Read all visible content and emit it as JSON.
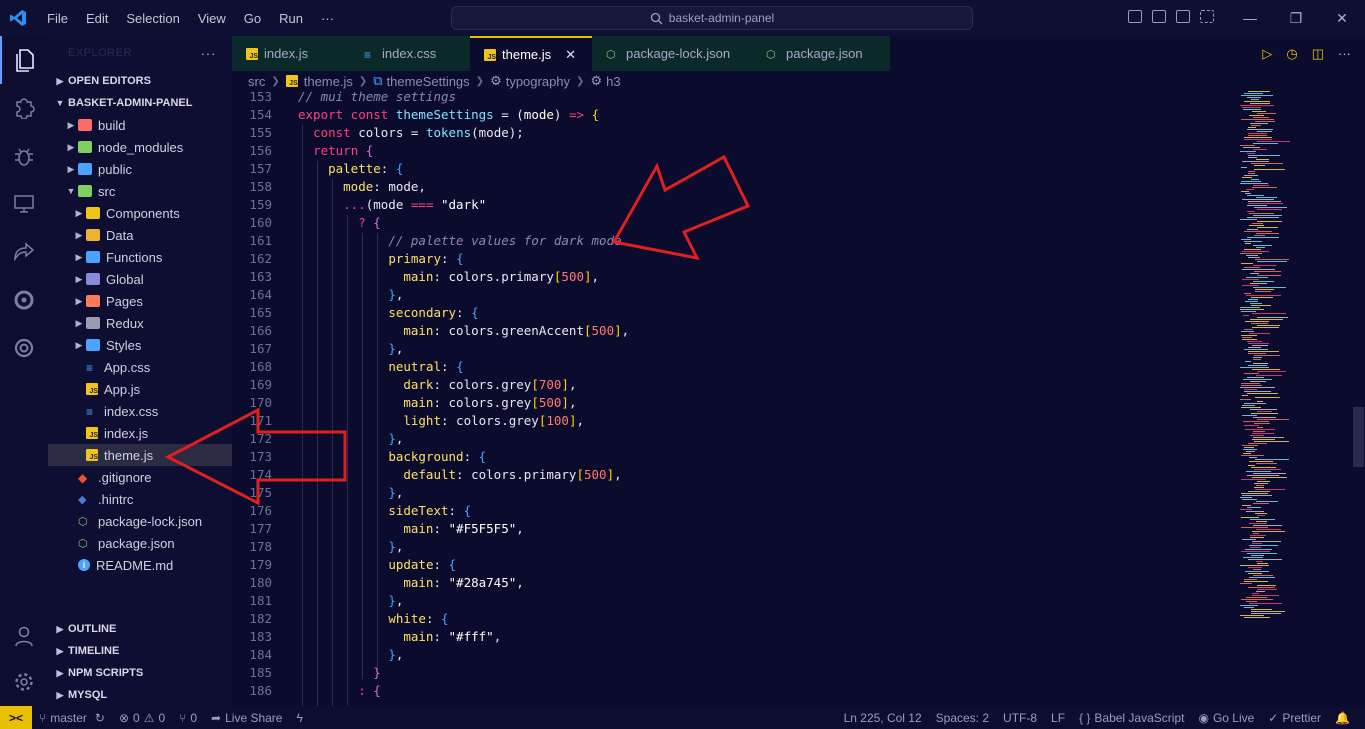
{
  "titlebar": {
    "menu": [
      "File",
      "Edit",
      "Selection",
      "View",
      "Go",
      "Run",
      "···"
    ],
    "search": "basket-admin-panel"
  },
  "sidebar": {
    "header": "EXPLORER",
    "sections": {
      "open_editors": "OPEN EDITORS",
      "project": "BASKET-ADMIN-PANEL",
      "outline": "OUTLINE",
      "timeline": "TIMELINE",
      "npm": "NPM SCRIPTS",
      "mysql": "MYSQL"
    },
    "tree": [
      {
        "label": "build",
        "type": "folder",
        "indent": 1,
        "color": "#ff6b6b"
      },
      {
        "label": "node_modules",
        "type": "folder",
        "indent": 1,
        "color": "#7fd060"
      },
      {
        "label": "public",
        "type": "folder",
        "indent": 1,
        "color": "#4aa3ff"
      },
      {
        "label": "src",
        "type": "folder-open",
        "indent": 1,
        "color": "#7fd060"
      },
      {
        "label": "Components",
        "type": "folder",
        "indent": 2,
        "color": "#f0c419"
      },
      {
        "label": "Data",
        "type": "folder",
        "indent": 2,
        "color": "#f0b030"
      },
      {
        "label": "Functions",
        "type": "folder",
        "indent": 2,
        "color": "#4aa3ff"
      },
      {
        "label": "Global",
        "type": "folder",
        "indent": 2,
        "color": "#8a8ad8"
      },
      {
        "label": "Pages",
        "type": "folder",
        "indent": 2,
        "color": "#ff7a5a"
      },
      {
        "label": "Redux",
        "type": "folder",
        "indent": 2,
        "color": "#9a9ab0"
      },
      {
        "label": "Styles",
        "type": "folder",
        "indent": 2,
        "color": "#4aa3ff"
      },
      {
        "label": "App.css",
        "type": "css",
        "indent": 2
      },
      {
        "label": "App.js",
        "type": "js",
        "indent": 2
      },
      {
        "label": "index.css",
        "type": "css",
        "indent": 2
      },
      {
        "label": "index.js",
        "type": "js",
        "indent": 2
      },
      {
        "label": "theme.js",
        "type": "js",
        "indent": 2,
        "selected": true
      },
      {
        "label": ".gitignore",
        "type": "git",
        "indent": 1
      },
      {
        "label": ".hintrc",
        "type": "hint",
        "indent": 1
      },
      {
        "label": "package-lock.json",
        "type": "json",
        "indent": 1
      },
      {
        "label": "package.json",
        "type": "json",
        "indent": 1
      },
      {
        "label": "README.md",
        "type": "info",
        "indent": 1
      }
    ]
  },
  "tabs": [
    {
      "label": "index.js",
      "type": "js"
    },
    {
      "label": "index.css",
      "type": "css"
    },
    {
      "label": "theme.js",
      "type": "js",
      "active": true
    },
    {
      "label": "package-lock.json",
      "type": "json"
    },
    {
      "label": "package.json",
      "type": "json"
    }
  ],
  "breadcrumb": [
    "src",
    "theme.js",
    "themeSettings",
    "typography",
    "h3"
  ],
  "code": [
    {
      "n": "153",
      "html": "<span class='cm'>// mui theme settings</span>"
    },
    {
      "n": "154",
      "html": "<span class='kw'>export const</span> <span class='fn'>themeSettings</span> = (<span class='str'>mode</span>) <span class='kw'>=&gt;</span> <span class='br1'>{</span>"
    },
    {
      "n": "155",
      "html": "  <span class='kw'>const</span> colors = <span class='fn'>tokens</span>(mode);"
    },
    {
      "n": "156",
      "html": "  <span class='kw'>return</span> <span class='br2'>{</span>"
    },
    {
      "n": "157",
      "html": "    <span class='prop'>palette</span>: <span class='br3'>{</span>"
    },
    {
      "n": "158",
      "html": "      <span class='prop'>mode</span>: mode,"
    },
    {
      "n": "159",
      "html": "      <span class='kw'>...</span>(mode <span class='kw'>===</span> <span class='str'>\"dark\"</span>"
    },
    {
      "n": "160",
      "html": "        <span class='kw'>?</span> <span class='br2'>{</span>"
    },
    {
      "n": "161",
      "html": "            <span class='cm'>// palette values for dark mode</span>"
    },
    {
      "n": "162",
      "html": "            <span class='prop'>primary</span>: <span class='br3'>{</span>"
    },
    {
      "n": "163",
      "html": "              <span class='prop'>main</span>: colors.primary<span class='br1'>[</span><span class='num'>500</span><span class='br1'>]</span>,"
    },
    {
      "n": "164",
      "html": "            <span class='br3'>}</span>,"
    },
    {
      "n": "165",
      "html": "            <span class='prop'>secondary</span>: <span class='br3'>{</span>"
    },
    {
      "n": "166",
      "html": "              <span class='prop'>main</span>: colors.greenAccent<span class='br1'>[</span><span class='num'>500</span><span class='br1'>]</span>,"
    },
    {
      "n": "167",
      "html": "            <span class='br3'>}</span>,"
    },
    {
      "n": "168",
      "html": "            <span class='prop'>neutral</span>: <span class='br3'>{</span>"
    },
    {
      "n": "169",
      "html": "              <span class='prop'>dark</span>: colors.grey<span class='br1'>[</span><span class='num'>700</span><span class='br1'>]</span>,"
    },
    {
      "n": "170",
      "html": "              <span class='prop'>main</span>: colors.grey<span class='br1'>[</span><span class='num'>500</span><span class='br1'>]</span>,"
    },
    {
      "n": "171",
      "html": "              <span class='prop'>light</span>: colors.grey<span class='br1'>[</span><span class='num'>100</span><span class='br1'>]</span>,"
    },
    {
      "n": "172",
      "html": "            <span class='br3'>}</span>,"
    },
    {
      "n": "173",
      "html": "            <span class='prop'>background</span>: <span class='br3'>{</span>"
    },
    {
      "n": "174",
      "html": "              <span class='prop'>default</span>: colors.primary<span class='br1'>[</span><span class='num'>500</span><span class='br1'>]</span>,"
    },
    {
      "n": "175",
      "html": "            <span class='br3'>}</span>,"
    },
    {
      "n": "176",
      "html": "            <span class='prop'>sideText</span>: <span class='br3'>{</span>"
    },
    {
      "n": "177",
      "html": "              <span class='prop'>main</span>: <span class='str'>\"#F5F5F5\"</span>,"
    },
    {
      "n": "178",
      "html": "            <span class='br3'>}</span>,"
    },
    {
      "n": "179",
      "html": "            <span class='prop'>update</span>: <span class='br3'>{</span>"
    },
    {
      "n": "180",
      "html": "              <span class='prop'>main</span>: <span class='str'>\"#28a745\"</span>,"
    },
    {
      "n": "181",
      "html": "            <span class='br3'>}</span>,"
    },
    {
      "n": "182",
      "html": "            <span class='prop'>white</span>: <span class='br3'>{</span>"
    },
    {
      "n": "183",
      "html": "              <span class='prop'>main</span>: <span class='str'>\"#fff\"</span>,"
    },
    {
      "n": "184",
      "html": "            <span class='br3'>}</span>,"
    },
    {
      "n": "185",
      "html": "          <span class='br2'>}</span>"
    },
    {
      "n": "186",
      "html": "        <span class='kw'>:</span> <span class='br2'>{</span>"
    }
  ],
  "status": {
    "branch": "master",
    "errors": "0",
    "warnings": "0",
    "ports": "0",
    "live_share": "Live Share",
    "position": "Ln 225, Col 12",
    "spaces": "Spaces: 2",
    "encoding": "UTF-8",
    "eol": "LF",
    "language": "Babel JavaScript",
    "go_live": "Go Live",
    "prettier": "Prettier"
  },
  "colors": {
    "accent": "#e8c000",
    "arrow": "#e02020",
    "background": "#0b0b2e"
  }
}
